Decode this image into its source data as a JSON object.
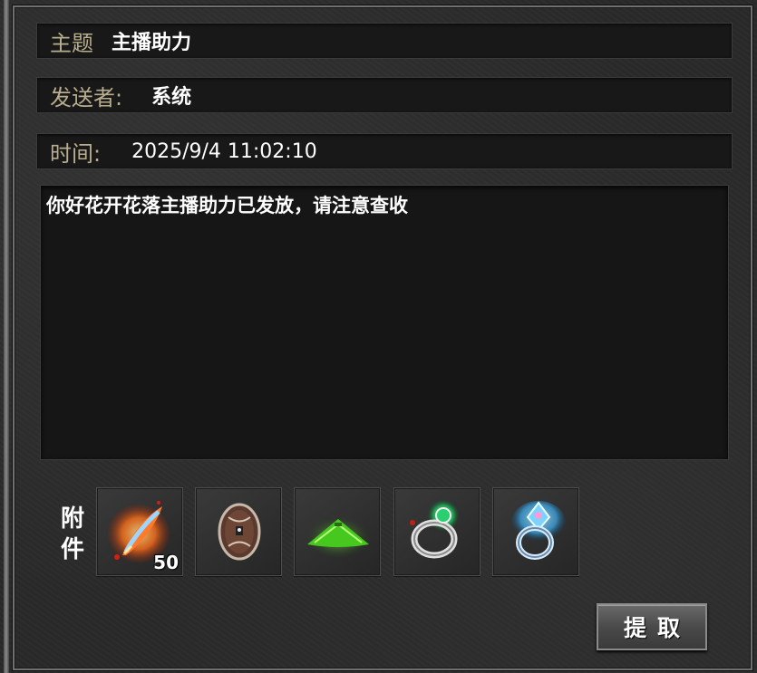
{
  "subject": {
    "label": "主题",
    "value": "主播助力"
  },
  "sender": {
    "label": "发送者:",
    "value": "系统"
  },
  "time": {
    "label": "时间:",
    "value": "2025/9/4 11:02:10"
  },
  "message": {
    "body": "你好花开花落主播助力已发放，请注意查收"
  },
  "attachments": {
    "label_line1": "附",
    "label_line2": "件",
    "items": [
      {
        "icon": "feather-fire-icon",
        "count": "50"
      },
      {
        "icon": "round-shield-icon",
        "count": ""
      },
      {
        "icon": "green-hat-icon",
        "count": ""
      },
      {
        "icon": "green-gem-ring-icon",
        "count": ""
      },
      {
        "icon": "blue-crystal-ring-icon",
        "count": ""
      }
    ]
  },
  "claim_button": {
    "label": "提取"
  },
  "colors": {
    "label_gold": "#b8ad8e",
    "text_white": "#ffffff",
    "panel_dark": "#181818"
  }
}
